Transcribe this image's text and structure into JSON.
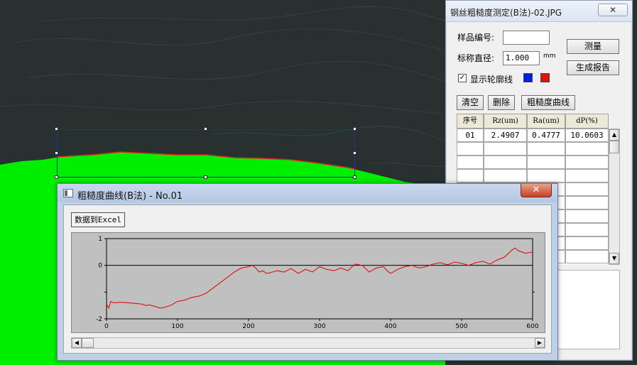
{
  "colors": {
    "contour_line": "#e02020",
    "selection_border": "#1f2fa0",
    "swatch_blue": "#0020e0",
    "swatch_red": "#e01010",
    "profile_green": "#00ee00",
    "curve_series": "#e00000"
  },
  "measure_dialog": {
    "title": "钢丝粗糙度测定(B法)-02.JPG",
    "close_glyph": "✕",
    "sample_no_label": "样品编号:",
    "sample_no_value": "",
    "diameter_label": "标称直径:",
    "diameter_value": "1.000",
    "diameter_unit": "mm",
    "measure_button": "测量",
    "report_button": "生成报告",
    "show_contour_label": "显示轮廓线",
    "show_contour_checked": "✓",
    "clear_button": "清空",
    "delete_button": "删除",
    "roughness_curve_button": "粗糙度曲线",
    "table": {
      "columns": [
        "序号",
        "Rz(um)",
        "Ra(um)",
        "dP(%)"
      ],
      "rows": [
        [
          "01",
          "2.4907",
          "0.4777",
          "10.0603"
        ]
      ]
    },
    "scroll_up": "▲",
    "scroll_down": "▼"
  },
  "curve_window": {
    "title": "粗糙度曲线(B法) - No.01",
    "close_glyph": "✕",
    "excel_button": "数据到Excel",
    "scroll_left": "◀",
    "scroll_right": "▶"
  },
  "chart_data": {
    "type": "line",
    "title": "",
    "xlabel": "",
    "ylabel": "",
    "xlim": [
      0,
      600
    ],
    "ylim": [
      -2,
      1
    ],
    "x_ticks": [
      0,
      100,
      200,
      300,
      400,
      500,
      600
    ],
    "y_ticks": [
      1,
      0,
      -2
    ],
    "grid": false,
    "series": [
      {
        "x": [
          0,
          3,
          6,
          10,
          20,
          30,
          40,
          50,
          55,
          60,
          70,
          75,
          80,
          90,
          100,
          110,
          120,
          130,
          140,
          150,
          160,
          170,
          180,
          190,
          200,
          205,
          210,
          215,
          220,
          225,
          230,
          240,
          250,
          260,
          270,
          280,
          290,
          300,
          310,
          320,
          330,
          340,
          350,
          360,
          370,
          380,
          390,
          395,
          400,
          410,
          420,
          430,
          440,
          450,
          460,
          470,
          480,
          490,
          500,
          510,
          520,
          530,
          540,
          550,
          560,
          570,
          575,
          580,
          590,
          600
        ],
        "y": [
          -1.45,
          -1.6,
          -1.35,
          -1.4,
          -1.38,
          -1.4,
          -1.42,
          -1.45,
          -1.5,
          -1.48,
          -1.55,
          -1.6,
          -1.58,
          -1.5,
          -1.35,
          -1.3,
          -1.2,
          -1.15,
          -1.05,
          -0.85,
          -0.65,
          -0.45,
          -0.25,
          -0.1,
          -0.05,
          0.0,
          -0.1,
          -0.25,
          -0.2,
          -0.3,
          -0.28,
          -0.2,
          -0.25,
          -0.12,
          -0.3,
          -0.15,
          -0.25,
          -0.05,
          -0.15,
          -0.2,
          -0.1,
          -0.2,
          0.05,
          0.0,
          -0.25,
          -0.1,
          -0.05,
          -0.2,
          -0.3,
          -0.15,
          -0.05,
          0.0,
          -0.1,
          -0.05,
          0.05,
          0.1,
          0.02,
          0.12,
          0.08,
          0.0,
          0.1,
          0.15,
          0.05,
          0.2,
          0.3,
          0.55,
          0.65,
          0.55,
          0.45,
          0.5
        ]
      }
    ]
  }
}
